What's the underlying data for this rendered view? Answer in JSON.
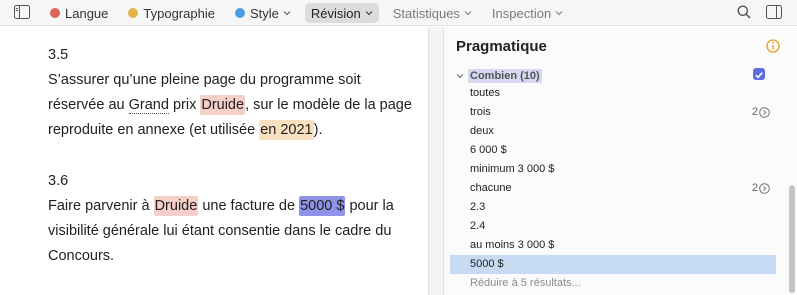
{
  "toolbar": {
    "tabs": [
      {
        "label": "Langue",
        "color": "#d9645a"
      },
      {
        "label": "Typographie",
        "color": "#e0b34a"
      },
      {
        "label": "Style",
        "color": "#4a9de0"
      },
      {
        "label": "Révision"
      },
      {
        "label": "Statistiques"
      },
      {
        "label": "Inspection"
      }
    ]
  },
  "document": {
    "p1_num": "3.5",
    "p1_l1": "S’assurer qu’une pleine page du programme soit",
    "p1_l2_a": "réservée au ",
    "p1_l2_grand": "Grand",
    "p1_l2_b": " prix ",
    "p1_l2_druide": "Druide",
    "p1_l2_c": ", sur le modèle de la page",
    "p1_l3_a": "reproduite en annexe (et utilisée ",
    "p1_l3_hl": "en 2021",
    "p1_l3_b": ").",
    "p2_num": "3.6",
    "p2_l1_a": "Faire parvenir à ",
    "p2_l1_druide": "Druide",
    "p2_l1_b": " une facture de ",
    "p2_l1_amount": "5000 $",
    "p2_l1_c": " pour la",
    "p2_l2": "visibilité générale lui étant consentie dans le cadre du",
    "p2_l3": "Concours."
  },
  "panel": {
    "title": "Pragmatique",
    "group": "Combien (10)",
    "items": [
      {
        "label": "toutes"
      },
      {
        "label": "trois",
        "count": "2"
      },
      {
        "label": "deux"
      },
      {
        "label": "6 000 $"
      },
      {
        "label": "minimum 3 000 $"
      },
      {
        "label": "chacune",
        "count": "2"
      },
      {
        "label": "2.3"
      },
      {
        "label": "2.4"
      },
      {
        "label": "au moins 3 000 $"
      },
      {
        "label": "5000 $"
      }
    ],
    "reduce": "Réduire à 5 résultats..."
  }
}
